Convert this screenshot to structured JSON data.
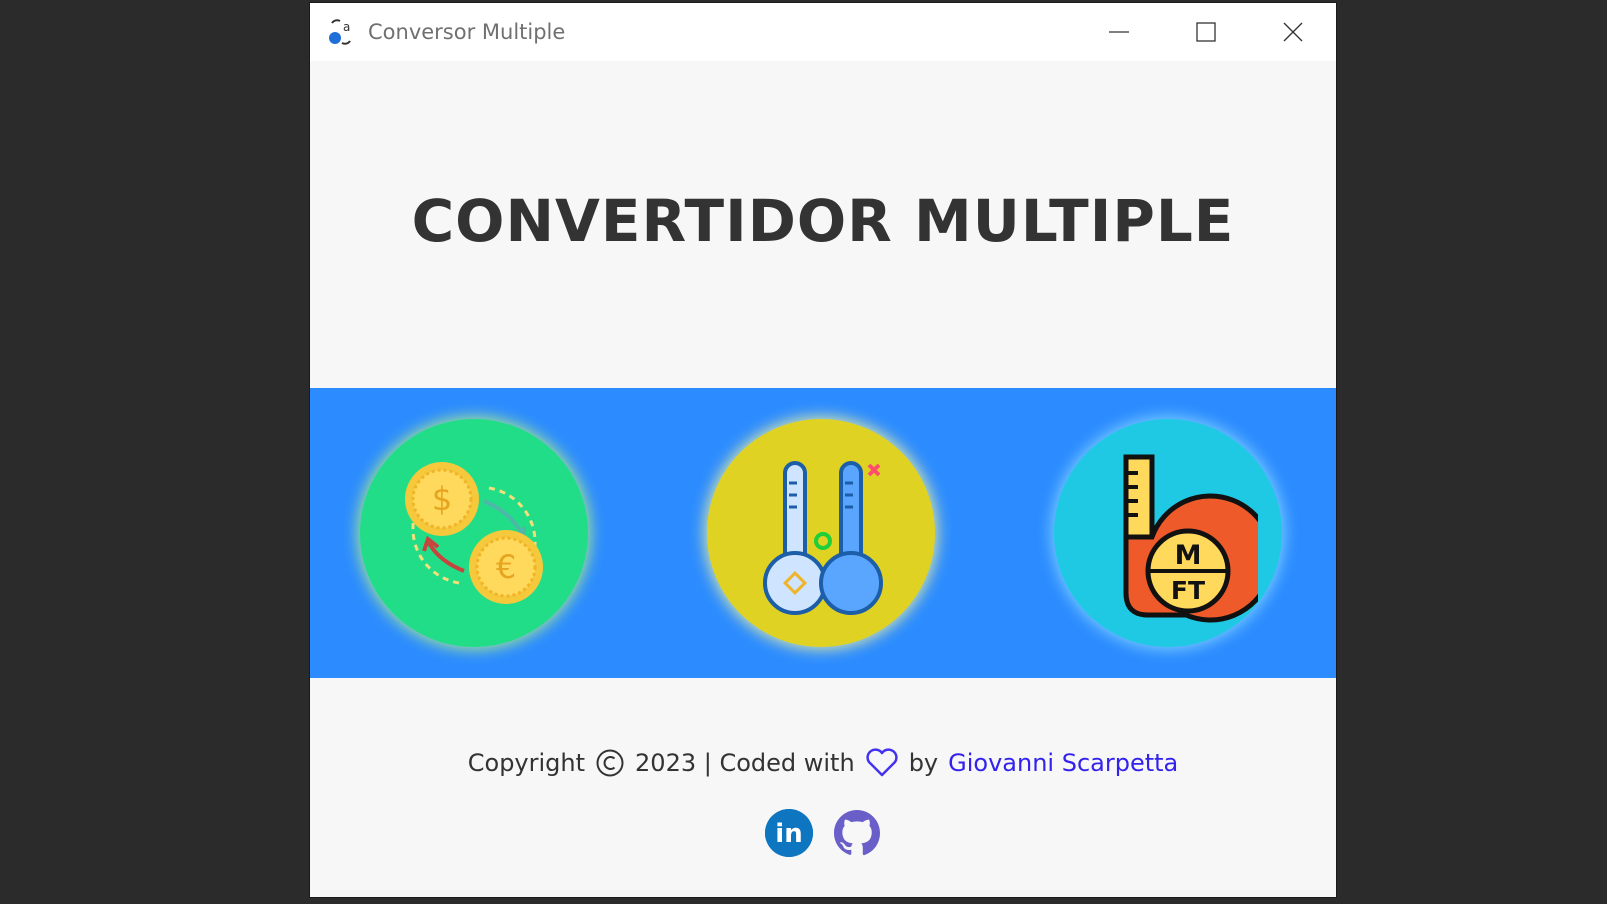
{
  "window": {
    "title": "Conversor Multiple",
    "minimize_icon": "minimize-icon",
    "maximize_icon": "maximize-icon",
    "close_icon": "close-icon"
  },
  "hero": {
    "title": "CONVERTIDOR MULTIPLE"
  },
  "tools": [
    {
      "name": "currency-converter",
      "icon": "currency-exchange-icon",
      "color": "#22dd88",
      "symbols": [
        "$",
        "€"
      ]
    },
    {
      "name": "temperature-converter",
      "icon": "thermometers-icon",
      "color": "#e0d223"
    },
    {
      "name": "length-converter",
      "icon": "tape-measure-icon",
      "color": "#20c9e3",
      "labels": [
        "M",
        "FT"
      ]
    }
  ],
  "footer": {
    "copyright_label": "Copyright",
    "year_text": "2023 | Coded with",
    "by_label": "by",
    "author": "Giovanni Scarpetta",
    "author_color": "#3322ee",
    "heart_color": "#4433ee"
  },
  "socials": [
    {
      "name": "linkedin",
      "icon": "linkedin-icon",
      "glyph": "in",
      "color": "#0e76c0"
    },
    {
      "name": "github",
      "icon": "github-icon",
      "color": "#6a5fc8"
    }
  ],
  "colors": {
    "band": "#2c8cff",
    "background": "#f7f7f7",
    "title": "#333333"
  }
}
